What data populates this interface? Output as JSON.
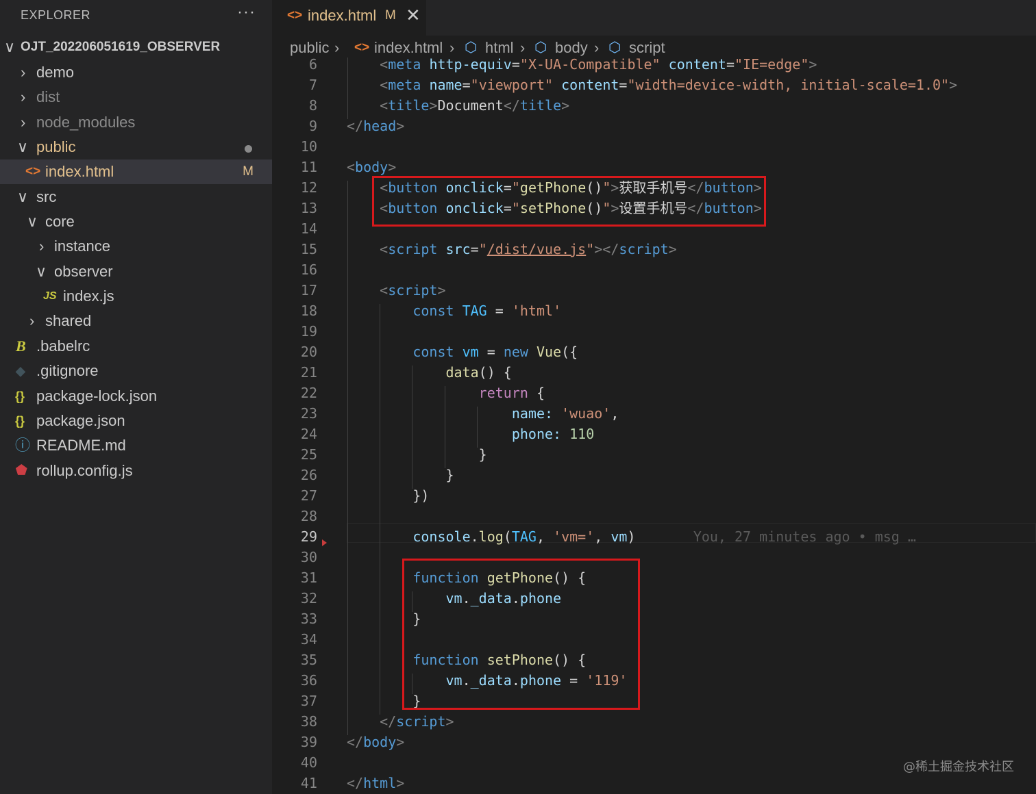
{
  "sidebar": {
    "title": "EXPLORER",
    "more_icon": "···",
    "root": "OJT_202206051619_OBSERVER",
    "items": [
      {
        "label": "demo",
        "twistie": "›"
      },
      {
        "label": "dist",
        "twistie": "›"
      },
      {
        "label": "node_modules",
        "twistie": "›"
      },
      {
        "label": "public",
        "twistie": "∨"
      },
      {
        "label": "index.html",
        "icon": "<>",
        "badge": "M"
      },
      {
        "label": "src",
        "twistie": "∨"
      },
      {
        "label": "core",
        "twistie": "∨"
      },
      {
        "label": "instance",
        "twistie": "›"
      },
      {
        "label": "observer",
        "twistie": "∨"
      },
      {
        "label": "index.js",
        "icon": "JS"
      },
      {
        "label": "shared",
        "twistie": "›"
      },
      {
        "label": ".babelrc",
        "icon": "B"
      },
      {
        "label": ".gitignore",
        "icon": "◆"
      },
      {
        "label": "package-lock.json",
        "icon": "{}"
      },
      {
        "label": "package.json",
        "icon": "{}"
      },
      {
        "label": "README.md",
        "icon": "ⓘ"
      },
      {
        "label": "rollup.config.js",
        "icon": "⬟"
      }
    ]
  },
  "tab": {
    "icon": "<>",
    "label": "index.html",
    "badge": "M",
    "close": "✕"
  },
  "breadcrumb": {
    "items": [
      "public",
      "index.html",
      "html",
      "body",
      "script"
    ],
    "separator": "›",
    "file_icon": "<>",
    "element_icon": "⬡"
  },
  "code": {
    "lines": [
      {
        "n": "6",
        "html": "    <span class=\"t-br\">&lt;</span><span class=\"t-tag\">meta</span> <span class=\"t-attr\">http-equiv</span><span class=\"t-pl\">=</span><span class=\"t-str\">\"X-UA-Compatible\"</span> <span class=\"t-attr\">content</span><span class=\"t-pl\">=</span><span class=\"t-str\">\"IE=edge\"</span><span class=\"t-br\">&gt;</span>"
      },
      {
        "n": "7",
        "html": "    <span class=\"t-br\">&lt;</span><span class=\"t-tag\">meta</span> <span class=\"t-attr\">name</span><span class=\"t-pl\">=</span><span class=\"t-str\">\"viewport\"</span> <span class=\"t-attr\">content</span><span class=\"t-pl\">=</span><span class=\"t-str\">\"width=device-width, initial-scale=1.0\"</span><span class=\"t-br\">&gt;</span>"
      },
      {
        "n": "8",
        "html": "    <span class=\"t-br\">&lt;</span><span class=\"t-tag\">title</span><span class=\"t-br\">&gt;</span><span class=\"t-text\">Document</span><span class=\"t-br\">&lt;/</span><span class=\"t-tag\">title</span><span class=\"t-br\">&gt;</span>"
      },
      {
        "n": "9",
        "html": "<span class=\"t-br\">&lt;/</span><span class=\"t-tag\">head</span><span class=\"t-br\">&gt;</span>"
      },
      {
        "n": "10",
        "html": ""
      },
      {
        "n": "11",
        "html": "<span class=\"t-br\">&lt;</span><span class=\"t-tag\">body</span><span class=\"t-br\">&gt;</span>"
      },
      {
        "n": "12",
        "html": "    <span class=\"t-br\">&lt;</span><span class=\"t-tag\">button</span> <span class=\"t-attr\">onclick</span><span class=\"t-pl\">=</span><span class=\"t-str\">\"</span><span class=\"t-fn\">getPhone</span><span class=\"t-pl\">()</span><span class=\"t-str\">\"</span><span class=\"t-br\">&gt;</span><span class=\"t-text\">获取手机号</span><span class=\"t-br\">&lt;/</span><span class=\"t-tag\">button</span><span class=\"t-br\">&gt;</span>"
      },
      {
        "n": "13",
        "html": "    <span class=\"t-br\">&lt;</span><span class=\"t-tag\">button</span> <span class=\"t-attr\">onclick</span><span class=\"t-pl\">=</span><span class=\"t-str\">\"</span><span class=\"t-fn\">setPhone</span><span class=\"t-pl\">()</span><span class=\"t-str\">\"</span><span class=\"t-br\">&gt;</span><span class=\"t-text\">设置手机号</span><span class=\"t-br\">&lt;/</span><span class=\"t-tag\">button</span><span class=\"t-br\">&gt;</span>"
      },
      {
        "n": "14",
        "html": ""
      },
      {
        "n": "15",
        "html": "    <span class=\"t-br\">&lt;</span><span class=\"t-tag\">script</span> <span class=\"t-attr\">src</span><span class=\"t-pl\">=</span><span class=\"t-str\">\"</span><span class=\"t-link\">/dist/vue.js</span><span class=\"t-str\">\"</span><span class=\"t-br\">&gt;&lt;/</span><span class=\"t-tag\">script</span><span class=\"t-br\">&gt;</span>"
      },
      {
        "n": "16",
        "html": ""
      },
      {
        "n": "17",
        "html": "    <span class=\"t-br\">&lt;</span><span class=\"t-tag\">script</span><span class=\"t-br\">&gt;</span>"
      },
      {
        "n": "18",
        "html": "        <span class=\"t-kw\">const</span> <span class=\"t-var\">TAG</span> <span class=\"t-pl\">=</span> <span class=\"t-str\">'html'</span>"
      },
      {
        "n": "19",
        "html": ""
      },
      {
        "n": "20",
        "html": "        <span class=\"t-kw\">const</span> <span class=\"t-var\">vm</span> <span class=\"t-pl\">=</span> <span class=\"t-kw\">new</span> <span class=\"t-fn\">Vue</span><span class=\"t-pl\">({</span>"
      },
      {
        "n": "21",
        "html": "            <span class=\"t-fn\">data</span><span class=\"t-pl\">() {</span>"
      },
      {
        "n": "22",
        "html": "                <span class=\"t-ctrl\">return</span> <span class=\"t-pl\">{</span>"
      },
      {
        "n": "23",
        "html": "                    <span class=\"t-prop\">name:</span> <span class=\"t-str\">'wuao'</span><span class=\"t-pl\">,</span>"
      },
      {
        "n": "24",
        "html": "                    <span class=\"t-prop\">phone:</span> <span class=\"t-num\">110</span>"
      },
      {
        "n": "25",
        "html": "                <span class=\"t-pl\">}</span>"
      },
      {
        "n": "26",
        "html": "            <span class=\"t-pl\">}</span>"
      },
      {
        "n": "27",
        "html": "        <span class=\"t-pl\">})</span>"
      },
      {
        "n": "28",
        "html": ""
      },
      {
        "n": "29",
        "html": "        <span class=\"t-prop\">console</span><span class=\"t-pl\">.</span><span class=\"t-fn\">log</span><span class=\"t-pl\">(</span><span class=\"t-var\">TAG</span><span class=\"t-pl\">,</span> <span class=\"t-str\">'vm='</span><span class=\"t-pl\">,</span> <span class=\"t-prop\">vm</span><span class=\"t-pl\">)</span>       <span class=\"blame\">You, 27 minutes ago • msg …</span>"
      },
      {
        "n": "30",
        "html": ""
      },
      {
        "n": "31",
        "html": "        <span class=\"t-kw\">function</span> <span class=\"t-fn\">getPhone</span><span class=\"t-pl\">() {</span>"
      },
      {
        "n": "32",
        "html": "            <span class=\"t-prop\">vm</span><span class=\"t-pl\">.</span><span class=\"t-prop\">_data</span><span class=\"t-pl\">.</span><span class=\"t-prop\">phone</span>"
      },
      {
        "n": "33",
        "html": "        <span class=\"t-pl\">}</span>"
      },
      {
        "n": "34",
        "html": ""
      },
      {
        "n": "35",
        "html": "        <span class=\"t-kw\">function</span> <span class=\"t-fn\">setPhone</span><span class=\"t-pl\">() {</span>"
      },
      {
        "n": "36",
        "html": "            <span class=\"t-prop\">vm</span><span class=\"t-pl\">.</span><span class=\"t-prop\">_data</span><span class=\"t-pl\">.</span><span class=\"t-prop\">phone</span> <span class=\"t-pl\">=</span> <span class=\"t-str\">'119'</span>"
      },
      {
        "n": "37",
        "html": "        <span class=\"t-pl\">}</span>"
      },
      {
        "n": "38",
        "html": "    <span class=\"t-br\">&lt;/</span><span class=\"t-tag\">script</span><span class=\"t-br\">&gt;</span>"
      },
      {
        "n": "39",
        "html": "<span class=\"t-br\">&lt;/</span><span class=\"t-tag\">body</span><span class=\"t-br\">&gt;</span>"
      },
      {
        "n": "40",
        "html": ""
      },
      {
        "n": "41",
        "html": "<span class=\"t-br\">&lt;/</span><span class=\"t-tag\">html</span><span class=\"t-br\">&gt;</span>"
      }
    ],
    "current_line": "29"
  },
  "watermark": "@稀土掘金技术社区",
  "colors": {
    "highlight_box": "#d7191c",
    "modified": "#e2c08d",
    "background": "#1e1e1e",
    "sidebar_bg": "#252526"
  }
}
